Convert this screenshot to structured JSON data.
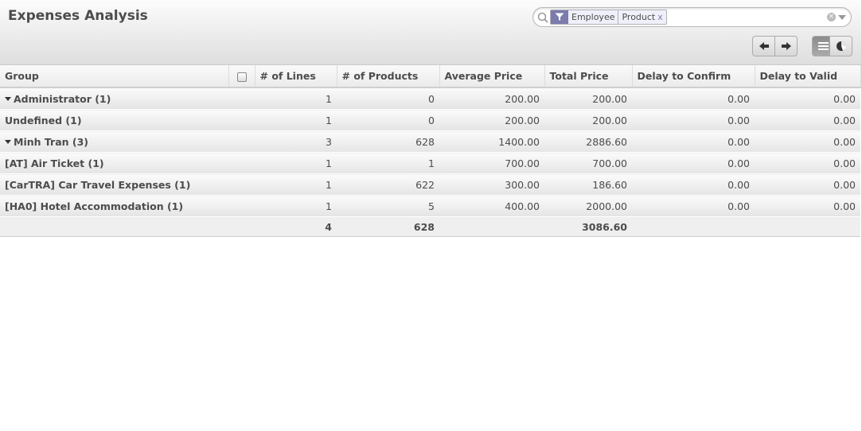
{
  "header": {
    "title": "Expenses Analysis"
  },
  "search": {
    "facet": {
      "category_icon": "filter-icon",
      "values": [
        "Employee",
        "Product"
      ],
      "remove": "x"
    },
    "colors": {
      "facet_category": "#7c7bad"
    }
  },
  "table": {
    "columns": [
      "Group",
      "# of Lines",
      "# of Products",
      "Average Price",
      "Total Price",
      "Delay to Confirm",
      "Delay to Valid"
    ],
    "rows": [
      {
        "label": "Administrator (1)",
        "lines": "1",
        "products": "0",
        "avg": "200.00",
        "total": "200.00",
        "confirm": "0.00",
        "valid": "0.00"
      },
      {
        "label": "Undefined (1)",
        "lines": "1",
        "products": "0",
        "avg": "200.00",
        "total": "200.00",
        "confirm": "0.00",
        "valid": "0.00"
      },
      {
        "label": "Minh Tran (3)",
        "lines": "3",
        "products": "628",
        "avg": "1400.00",
        "total": "2886.60",
        "confirm": "0.00",
        "valid": "0.00"
      },
      {
        "label": "[AT] Air Ticket (1)",
        "lines": "1",
        "products": "1",
        "avg": "700.00",
        "total": "700.00",
        "confirm": "0.00",
        "valid": "0.00"
      },
      {
        "label": "[CarTRA] Car Travel Expenses (1)",
        "lines": "1",
        "products": "622",
        "avg": "300.00",
        "total": "186.60",
        "confirm": "0.00",
        "valid": "0.00"
      },
      {
        "label": "[HA0] Hotel Accommodation (1)",
        "lines": "1",
        "products": "5",
        "avg": "400.00",
        "total": "2000.00",
        "confirm": "0.00",
        "valid": "0.00"
      }
    ],
    "totals": {
      "lines": "4",
      "products": "628",
      "total": "3086.60"
    }
  }
}
